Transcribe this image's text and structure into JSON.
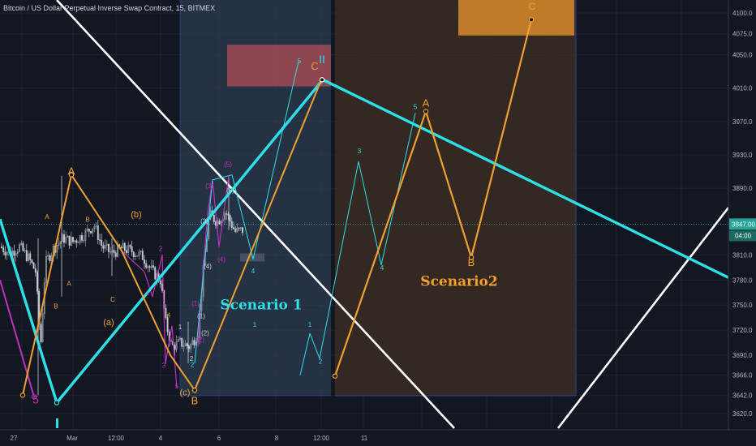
{
  "header": {
    "title": "Bitcoin / US Dollar Perpetual Inverse Swap Contract, 15, BITMEX"
  },
  "price_tags": {
    "current": "3847.00",
    "countdown": "04:00"
  },
  "colors": {
    "background": "#131722",
    "candle_up": "#9aa0a6",
    "candle_down": "#c8ccd2",
    "cyan": "#2de0e8",
    "orange": "#f0a030",
    "magenta": "#c030c0",
    "white": "#ffffff",
    "zone_blue": "#34495e",
    "zone_brown": "#3a2c22",
    "target_red": "#a04a52",
    "target_orange": "#d88a2a"
  },
  "annotations": {
    "scenario1": "Scenario 1",
    "scenario2": "Scenario2"
  },
  "chart_data": {
    "type": "candlestick",
    "title": "Bitcoin / US Dollar Perpetual Inverse Swap Contract, 15, BITMEX",
    "y_ticks": [
      4100,
      4075,
      4050,
      4010,
      3970,
      3930,
      3890,
      3810,
      3780,
      3750,
      3720,
      3690,
      3666,
      3642,
      3620
    ],
    "y_tick_labels": [
      "4100.0",
      "4075.0",
      "4050.0",
      "4010.0",
      "3970.0",
      "3930.0",
      "3890.0",
      "3810.0",
      "3780.0",
      "3750.0",
      "3720.0",
      "3690.0",
      "3666.0",
      "3642.0",
      "3620.0"
    ],
    "x_tick_labels": [
      "27",
      "Mar",
      "12:00",
      "4",
      "6",
      "8",
      "12:00",
      "11"
    ],
    "current_price": 3847.0,
    "grid": true,
    "wave_labels": [
      {
        "text": "A",
        "price": 3906,
        "color": "orange",
        "size": 13
      },
      {
        "text": "C",
        "price": 4032,
        "color": "orange",
        "size": 13
      },
      {
        "text": "II",
        "price": 4040,
        "color": "cyan",
        "size": 14
      },
      {
        "text": "A",
        "price": 3988,
        "color": "orange",
        "size": 13
      },
      {
        "text": "C",
        "price": 4104,
        "color": "orange",
        "size": 12
      },
      {
        "text": "B",
        "price": 3797,
        "color": "orange",
        "size": 13
      },
      {
        "text": "B",
        "price": 3631,
        "color": "orange",
        "size": 13
      },
      {
        "text": "(b)",
        "price": 3855,
        "color": "orange",
        "size": 11
      },
      {
        "text": "(a)",
        "price": 3726,
        "color": "orange",
        "size": 11
      },
      {
        "text": "(c)",
        "price": 3642,
        "color": "orange",
        "size": 11
      },
      {
        "text": "5",
        "price": 3632,
        "color": "magenta",
        "size": 14
      },
      {
        "text": "A",
        "price": 3853,
        "color": "orange",
        "size": 8
      },
      {
        "text": "B",
        "price": 3850,
        "color": "orange",
        "size": 8
      },
      {
        "text": "A",
        "price": 3773,
        "color": "orange",
        "size": 8
      },
      {
        "text": "B",
        "price": 3746,
        "color": "orange",
        "size": 8
      },
      {
        "text": "C",
        "price": 3754,
        "color": "orange",
        "size": 8
      },
      {
        "text": "2",
        "price": 3815,
        "color": "magenta",
        "size": 8
      },
      {
        "text": "1",
        "price": 3762,
        "color": "magenta",
        "size": 8
      },
      {
        "text": "3",
        "price": 3675,
        "color": "magenta",
        "size": 8
      },
      {
        "text": "4",
        "price": 3735,
        "color": "orange",
        "size": 8
      },
      {
        "text": "5",
        "price": 3650,
        "color": "magenta",
        "size": 8
      },
      {
        "text": "1",
        "price": 3724,
        "color": "cyan",
        "size": 8
      },
      {
        "text": "2",
        "price": 3676,
        "color": "cyan",
        "size": 8
      },
      {
        "text": "5",
        "price": 4040,
        "color": "cyan",
        "size": 8
      },
      {
        "text": "4",
        "price": 3788,
        "color": "cyan",
        "size": 8
      },
      {
        "text": "1",
        "price": 3724,
        "color": "cyan",
        "size": 8
      },
      {
        "text": "2",
        "price": 3680,
        "color": "cyan",
        "size": 8
      },
      {
        "text": "3",
        "price": 3932,
        "color": "cyan",
        "size": 8
      },
      {
        "text": "4",
        "price": 3792,
        "color": "cyan",
        "size": 8
      },
      {
        "text": "5",
        "price": 3985,
        "color": "cyan",
        "size": 8
      },
      {
        "text": "(1)",
        "price": 3749,
        "color": "magenta",
        "size": 8
      },
      {
        "text": "(2)",
        "price": 3706,
        "color": "magenta",
        "size": 8
      },
      {
        "text": "(3)",
        "price": 3890,
        "color": "magenta",
        "size": 8
      },
      {
        "text": "(4)",
        "price": 3802,
        "color": "magenta",
        "size": 8
      },
      {
        "text": "(5)",
        "price": 3916,
        "color": "magenta",
        "size": 8
      },
      {
        "text": "(3)",
        "price": 3848,
        "color": "white",
        "size": 8
      },
      {
        "text": "(4)",
        "price": 3794,
        "color": "white",
        "size": 8
      },
      {
        "text": "(5)",
        "price": 3885,
        "color": "white",
        "size": 8
      },
      {
        "text": "(1)",
        "price": 3734,
        "color": "white",
        "size": 8
      },
      {
        "text": "(2)",
        "price": 3714,
        "color": "white",
        "size": 8
      },
      {
        "text": "1",
        "price": 3721,
        "color": "white",
        "size": 8
      },
      {
        "text": "2",
        "price": 3683,
        "color": "white",
        "size": 8
      }
    ]
  }
}
